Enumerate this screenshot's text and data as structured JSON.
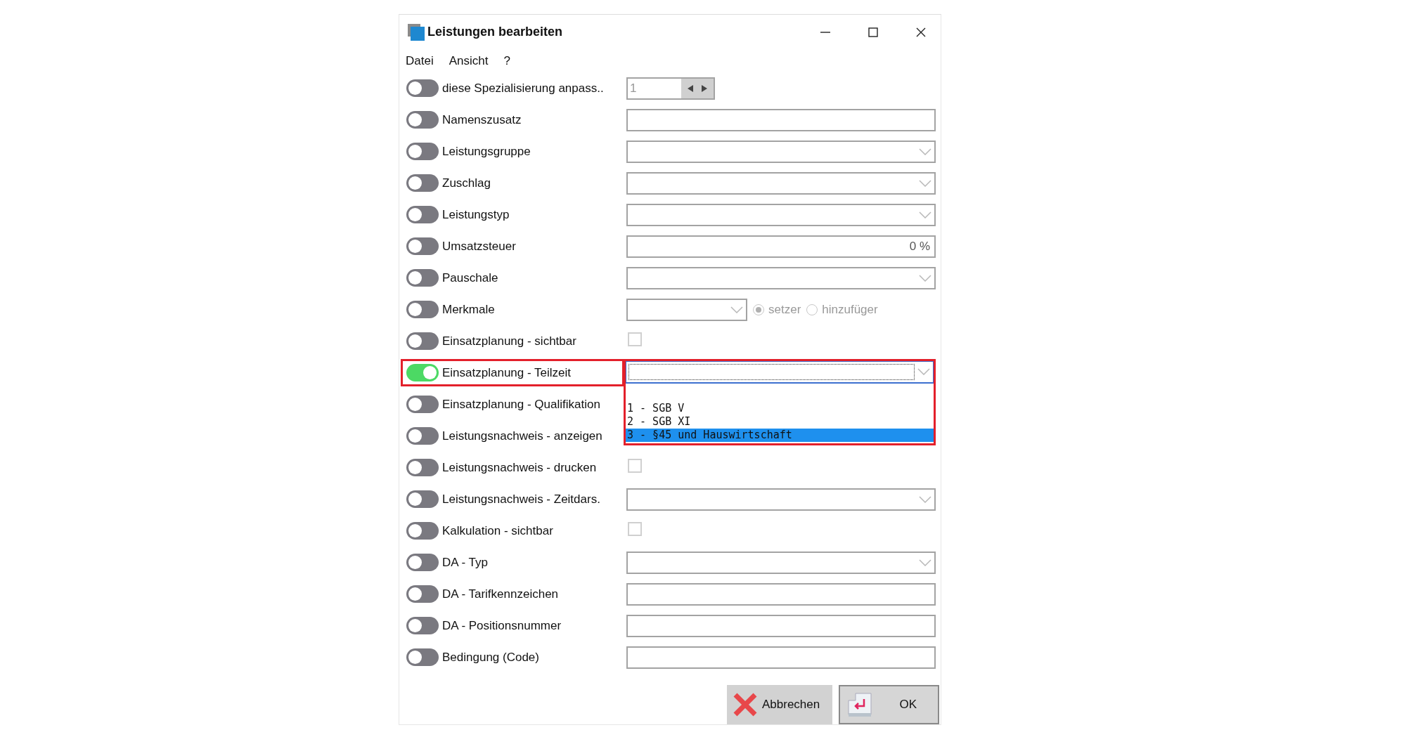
{
  "window": {
    "title": "Leistungen bearbeiten"
  },
  "menu": [
    {
      "label": "Datei"
    },
    {
      "label": "Ansicht"
    },
    {
      "label": "?"
    }
  ],
  "rows": [
    {
      "label": "diese Spezialisierung anpass..",
      "on": false,
      "highlighted": false,
      "kind": "spinner",
      "value": "1"
    },
    {
      "label": "Namenszusatz",
      "on": false,
      "highlighted": false,
      "kind": "text"
    },
    {
      "label": "Leistungsgruppe",
      "on": false,
      "highlighted": false,
      "kind": "combo",
      "expanded": false
    },
    {
      "label": "Zuschlag",
      "on": false,
      "highlighted": false,
      "kind": "combo",
      "expanded": false
    },
    {
      "label": "Leistungstyp",
      "on": false,
      "highlighted": false,
      "kind": "combo",
      "expanded": false
    },
    {
      "label": "Umsatzsteuer",
      "on": false,
      "highlighted": false,
      "kind": "number",
      "value": "0 %"
    },
    {
      "label": "Pauschale",
      "on": false,
      "highlighted": false,
      "kind": "combo",
      "expanded": false
    },
    {
      "label": "Merkmale",
      "on": false,
      "highlighted": false,
      "kind": "combo-radio",
      "options": [
        {
          "label": "setzer",
          "selected": true
        },
        {
          "label": "hinzufüger",
          "selected": false
        }
      ]
    },
    {
      "label": "Einsatzplanung - sichtbar",
      "on": false,
      "highlighted": false,
      "kind": "checkbox",
      "checked": false
    },
    {
      "label": "Einsatzplanung - Teilzeit",
      "on": true,
      "highlighted": true,
      "kind": "combo",
      "expanded": true,
      "options": [
        {
          "label": "1 - SGB V",
          "selected": false
        },
        {
          "label": "2 - SGB XI",
          "selected": false
        },
        {
          "label": "3 - §45 und Hauswirtschaft",
          "selected": true
        }
      ]
    },
    {
      "label": "Einsatzplanung - Qualifikation",
      "on": false,
      "highlighted": false,
      "kind": "covered"
    },
    {
      "label": "Leistungsnachweis - anzeigen",
      "on": false,
      "highlighted": false,
      "kind": "covered"
    },
    {
      "label": "Leistungsnachweis - drucken",
      "on": false,
      "highlighted": false,
      "kind": "checkbox",
      "checked": false
    },
    {
      "label": "Leistungsnachweis - Zeitdars.",
      "on": false,
      "highlighted": false,
      "kind": "combo",
      "expanded": false
    },
    {
      "label": "Kalkulation - sichtbar",
      "on": false,
      "highlighted": false,
      "kind": "checkbox",
      "checked": false
    },
    {
      "label": "DA - Typ",
      "on": false,
      "highlighted": false,
      "kind": "combo",
      "expanded": false
    },
    {
      "label": "DA - Tarifkennzeichen",
      "on": false,
      "highlighted": false,
      "kind": "text"
    },
    {
      "label": "DA - Positionsnummer",
      "on": false,
      "highlighted": false,
      "kind": "text"
    },
    {
      "label": "Bedingung (Code)",
      "on": false,
      "highlighted": false,
      "kind": "text"
    }
  ],
  "buttons": [
    {
      "label": "Abbrechen",
      "kind": "cancel"
    },
    {
      "label": "OK",
      "kind": "ok"
    }
  ]
}
